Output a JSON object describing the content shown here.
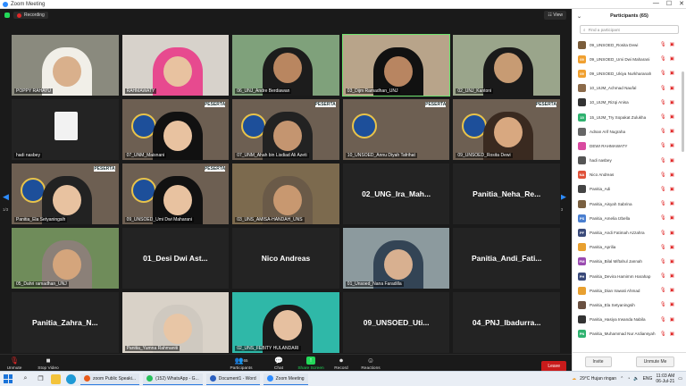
{
  "window": {
    "title": "Zoom Meeting",
    "controls": [
      "—",
      "☐",
      "✕"
    ]
  },
  "topbar": {
    "recording": "Recording",
    "view": "View"
  },
  "nav": {
    "left_arrow": "◀",
    "right_arrow": "▶",
    "page_left": "1/3",
    "page_right": "1/3"
  },
  "tiles": [
    {
      "name": "POPPY RAHAYU",
      "kind": "video"
    },
    {
      "name": "RAHMAWATY",
      "kind": "video"
    },
    {
      "name": "06_UNJ_Andre Berdiawan",
      "kind": "video"
    },
    {
      "name": "03_Dijm Ramadhan_UNJ",
      "kind": "video"
    },
    {
      "name": "02_UNJ_Kantoni",
      "kind": "video"
    },
    {
      "name": "hadi nasbey",
      "kind": "video"
    },
    {
      "name": "07_UNM_Maisnani",
      "kind": "video"
    },
    {
      "name": "07_UNM_Ahah bin Lisdiad Ali Azeti",
      "kind": "video"
    },
    {
      "name": "10_UNSOED_Annu Diyah Tafrihat",
      "kind": "video"
    },
    {
      "name": "09_UNSOED_Rosita Dewi",
      "kind": "video"
    },
    {
      "name": "Panitia_Ela Setyaningsih",
      "kind": "video"
    },
    {
      "name": "09_UNSOED_Umi Dwi Maharani",
      "kind": "video"
    },
    {
      "name": "03_UNS_AMISA-HANDAH_UNS",
      "kind": "video"
    },
    {
      "name": "02_UNG_Ira_Mah...",
      "kind": "text"
    },
    {
      "name": "Panitia_Neha_Re...",
      "kind": "text"
    },
    {
      "name": "05_Dahri ramadhan_UNJ",
      "kind": "video"
    },
    {
      "name": "01_Desi Dwi Ast...",
      "kind": "text"
    },
    {
      "name": "Nico Andreas",
      "kind": "text"
    },
    {
      "name": "01_Unsoed_Nana Faradilla",
      "kind": "video"
    },
    {
      "name": "Panitia_Andi_Fati...",
      "kind": "text"
    },
    {
      "name": "Panitia_Zahra_N...",
      "kind": "text"
    },
    {
      "name": "Panitia_Yumna Rahmaniti",
      "kind": "video"
    },
    {
      "name": "02_UNS_FEBITY HULANDARI",
      "kind": "video"
    },
    {
      "name": "09_UNSOED_Uti...",
      "kind": "text"
    },
    {
      "name": "04_PNJ_Ibadurra...",
      "kind": "text"
    }
  ],
  "peserta_label": "PESERTA",
  "controls": {
    "unmute": "Unmute",
    "stop_video": "Stop Video",
    "participants": "Participants",
    "participants_count": "65",
    "chat": "Chat",
    "share": "Share Screen",
    "record": "Record",
    "reactions": "Reactions",
    "leave": "Leave"
  },
  "panel": {
    "title": "Participants (65)",
    "search_placeholder": "Find a participant",
    "participants": [
      {
        "name": "09_UNSOED_Rosita Dewi",
        "initials": "",
        "color": "#7a5c3a"
      },
      {
        "name": "09_UNSOED_Umi Dwi Maharani",
        "initials": "09",
        "color": "#f0a030"
      },
      {
        "name": "09_UNSOED_Ukiya Nurkharanah",
        "initials": "09",
        "color": "#f0a030"
      },
      {
        "name": "10_UIJM_Achmad Naufal",
        "initials": "",
        "color": "#8b6a4a"
      },
      {
        "name": "10_UIJM_Rizqi Anisa",
        "initials": "",
        "color": "#333333"
      },
      {
        "name": "15_UIJM_Try Sopakat Zulukha",
        "initials": "15",
        "color": "#2fb26f"
      },
      {
        "name": "Adnan Arif Nugraha",
        "initials": "",
        "color": "#666666"
      },
      {
        "name": "DEWI RAHMAWATY",
        "initials": "",
        "color": "#d94aa0"
      },
      {
        "name": "hadi nasbey",
        "initials": "",
        "color": "#555555"
      },
      {
        "name": "Nico Andreas",
        "initials": "NA",
        "color": "#e0523a"
      },
      {
        "name": "Panitia_Adi",
        "initials": "",
        "color": "#444444"
      },
      {
        "name": "Panitia_Aisyah Sabrina",
        "initials": "",
        "color": "#7a6040"
      },
      {
        "name": "Panitia_Amelia Izbella",
        "initials": "PS",
        "color": "#4a7fd0"
      },
      {
        "name": "Panitia_Andi Fatimah Azzahra",
        "initials": "PF",
        "color": "#3a4a7a"
      },
      {
        "name": "Panitia_Aprilia",
        "initials": "",
        "color": "#e8a030"
      },
      {
        "name": "Panitia_Bilal Miftahul Jannah",
        "initials": "PM",
        "color": "#9a4ab0"
      },
      {
        "name": "Panitia_Devira Hamimm Harahap",
        "initials": "PH",
        "color": "#3a4a7a"
      },
      {
        "name": "Panitia_Dian Irawati Ahmad",
        "initials": "",
        "color": "#e8a030"
      },
      {
        "name": "Panitia_Ela Setyaningsih",
        "initials": "",
        "color": "#6a5040"
      },
      {
        "name": "Panitia_Hasiya Irwanda Nabila",
        "initials": "",
        "color": "#333333"
      },
      {
        "name": "Panitia_Muhammad Nur Ardiansyah",
        "initials": "PN",
        "color": "#2fb26f"
      }
    ],
    "invite": "Invite",
    "unmute_me": "Unmute Me"
  },
  "taskbar": {
    "apps": [
      {
        "label": "zoom Public Speaki...",
        "color": "#e85a1a"
      },
      {
        "label": "(152) WhatsApp - G...",
        "color": "#25c05a"
      },
      {
        "label": "Document1 - Word",
        "color": "#2b5fbf"
      },
      {
        "label": "Zoom Meeting",
        "color": "#2d8cff"
      }
    ],
    "weather": "29°C  Hujan ringan",
    "lang": "ENG",
    "time": "11:03 AM",
    "date": "06-Jul-21"
  }
}
